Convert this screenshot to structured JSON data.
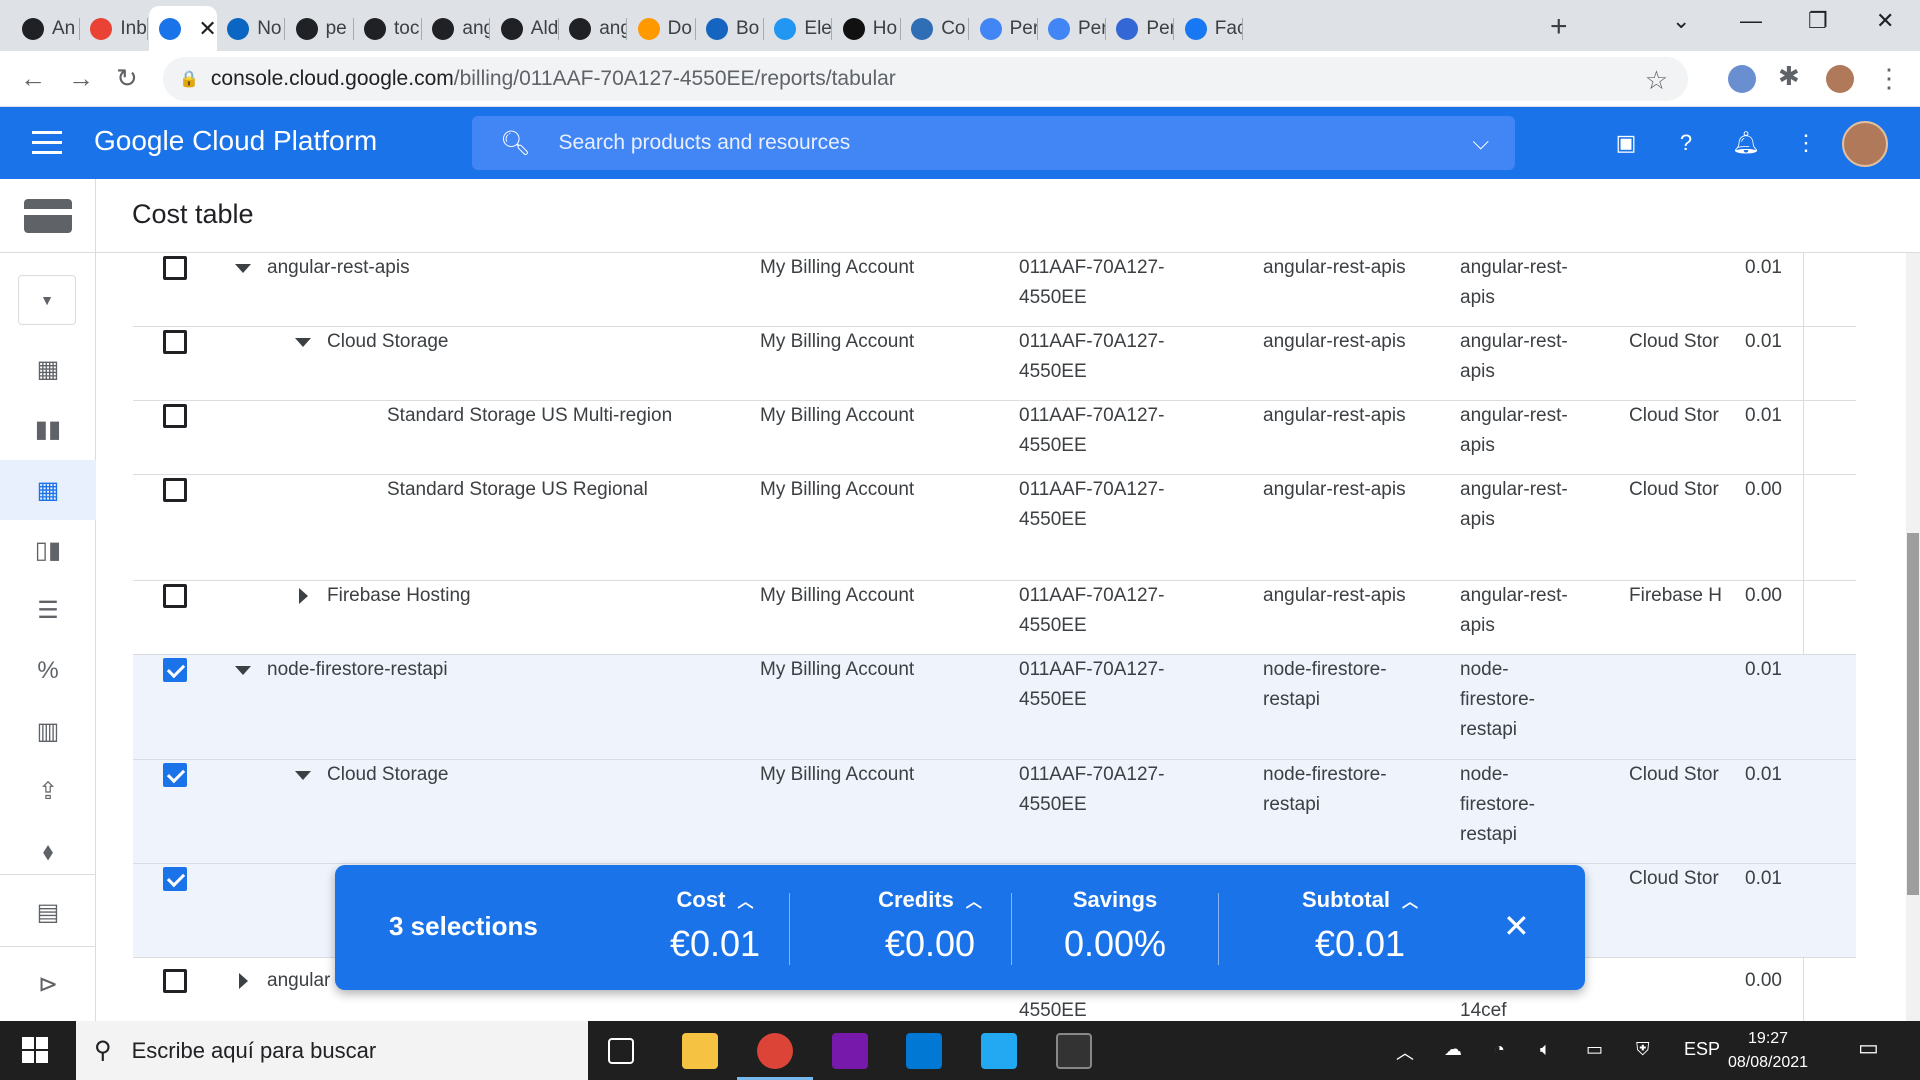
{
  "browser": {
    "tabs": [
      {
        "label": "An",
        "icon": "github-icon"
      },
      {
        "label": "Inb",
        "icon": "gmail-icon"
      },
      {
        "label": "",
        "icon": "billing-icon",
        "active": true
      },
      {
        "label": "No",
        "icon": "linkedin-icon"
      },
      {
        "label": "pe",
        "icon": "github-icon"
      },
      {
        "label": "toc",
        "icon": "github-icon"
      },
      {
        "label": "ang",
        "icon": "github-icon"
      },
      {
        "label": "Ald",
        "icon": "github-icon"
      },
      {
        "label": "ang",
        "icon": "github-icon"
      },
      {
        "label": "Do",
        "icon": "amazon-icon"
      },
      {
        "label": "Bo",
        "icon": "cart-icon"
      },
      {
        "label": "Ele",
        "icon": "elements-icon"
      },
      {
        "label": "Ho",
        "icon": "c-icon"
      },
      {
        "label": "Co",
        "icon": "pg-icon"
      },
      {
        "label": "Per",
        "icon": "google-icon"
      },
      {
        "label": "Per",
        "icon": "google-icon"
      },
      {
        "label": "Per",
        "icon": "translate-icon"
      },
      {
        "label": "Fac",
        "icon": "facebook-icon"
      }
    ],
    "url_host": "console.cloud.google.com",
    "url_path": "/billing/011AAF-70A127-4550EE/reports/tabular"
  },
  "header": {
    "title": "Google Cloud Platform",
    "search_placeholder": "Search products and resources"
  },
  "page": {
    "title": "Cost table"
  },
  "rows": [
    {
      "indent": 0,
      "caret": "down",
      "name": "angular-rest-apis",
      "account": "My Billing Account",
      "account_id": "011AAF-70A127-4550EE",
      "project": "angular-rest-apis",
      "project_id": "angular-rest-apis",
      "service": "",
      "cost": "0.01",
      "checked": false
    },
    {
      "indent": 1,
      "caret": "down",
      "name": "Cloud Storage",
      "account": "My Billing Account",
      "account_id": "011AAF-70A127-4550EE",
      "project": "angular-rest-apis",
      "project_id": "angular-rest-apis",
      "service": "Cloud Stor",
      "cost": "0.01",
      "checked": false
    },
    {
      "indent": 2,
      "caret": "",
      "name": "Standard Storage US Multi-region",
      "account": "My Billing Account",
      "account_id": "011AAF-70A127-4550EE",
      "project": "angular-rest-apis",
      "project_id": "angular-rest-apis",
      "service": "Cloud Stor",
      "cost": "0.01",
      "checked": false
    },
    {
      "indent": 2,
      "caret": "",
      "name": "Standard Storage US Regional",
      "account": "My Billing Account",
      "account_id": "011AAF-70A127-4550EE",
      "project": "angular-rest-apis",
      "project_id": "angular-rest-apis",
      "service": "Cloud Stor",
      "cost": "0.00",
      "checked": false
    },
    {
      "indent": 1,
      "caret": "right",
      "name": "Firebase Hosting",
      "account": "My Billing Account",
      "account_id": "011AAF-70A127-4550EE",
      "project": "angular-rest-apis",
      "project_id": "angular-rest-apis",
      "service": "Firebase H",
      "cost": "0.00",
      "checked": false
    },
    {
      "indent": 0,
      "caret": "down",
      "name": "node-firestore-restapi",
      "account": "My Billing Account",
      "account_id": "011AAF-70A127-4550EE",
      "project": "node-firestore-restapi",
      "project_id": "node-firestore-restapi",
      "service": "",
      "cost": "0.01",
      "checked": true
    },
    {
      "indent": 1,
      "caret": "down",
      "name": "Cloud Storage",
      "account": "My Billing Account",
      "account_id": "011AAF-70A127-4550EE",
      "project": "node-firestore-restapi",
      "project_id": "node-firestore-restapi",
      "service": "Cloud Stor",
      "cost": "0.01",
      "checked": true
    },
    {
      "indent": 2,
      "caret": "",
      "name": "",
      "account": "",
      "account_id": "",
      "project": "",
      "project_id": "",
      "service": "Cloud Stor",
      "cost": "0.01",
      "checked": true
    },
    {
      "indent": 0,
      "caret": "right",
      "name": "angular",
      "account": "",
      "account_id": "4550EE",
      "project": "",
      "project_id": "14cef",
      "service": "",
      "cost": "0.00",
      "checked": false
    }
  ],
  "selection_bar": {
    "count_label": "3 selections",
    "cost_label": "Cost",
    "cost_value": "€0.01",
    "credits_label": "Credits",
    "credits_value": "€0.00",
    "savings_label": "Savings",
    "savings_value": "0.00%",
    "subtotal_label": "Subtotal",
    "subtotal_value": "€0.01"
  },
  "taskbar": {
    "search_placeholder": "Escribe aquí para buscar",
    "lang": "ESP",
    "time": "19:27",
    "date": "08/08/2021"
  },
  "colors": {
    "gcp_blue": "#1a73e8",
    "selected_row": "#eef3fc"
  }
}
